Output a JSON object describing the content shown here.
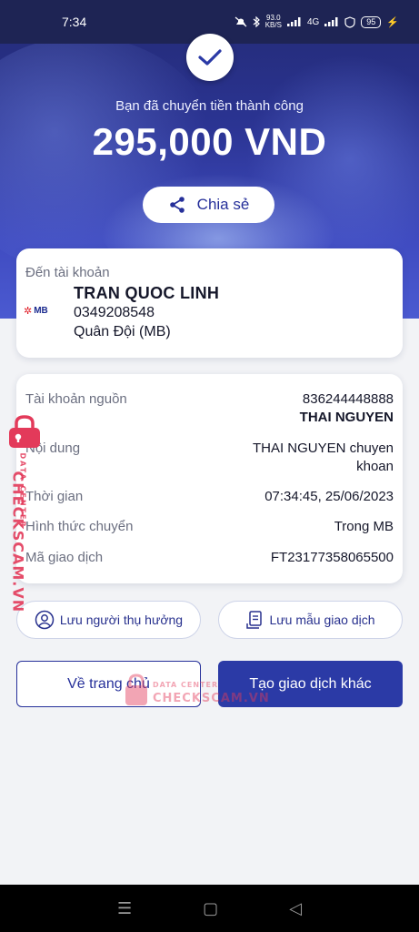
{
  "status": {
    "time": "7:34",
    "speed_value": "93.0",
    "speed_unit": "KB/S",
    "network": "4G",
    "battery": "95"
  },
  "hero": {
    "title": "Bạn đã chuyển tiền thành công",
    "amount": "295,000 VND",
    "share_label": "Chia sẻ"
  },
  "recipient": {
    "label": "Đến tài khoản",
    "bank_logo_text": "MB",
    "name": "TRAN QUOC LINH",
    "account": "0349208548",
    "bank": "Quân Đội (MB)"
  },
  "details": {
    "source_label": "Tài khoản nguồn",
    "source_account": "836244448888",
    "source_name": "THAI NGUYEN",
    "content_label": "Nội dung",
    "content_line1": "THAI NGUYEN chuyen",
    "content_line2": "khoan",
    "time_label": "Thời gian",
    "time_value": "07:34:45, 25/06/2023",
    "method_label": "Hình thức chuyển",
    "method_value": "Trong MB",
    "txn_label": "Mã giao dịch",
    "txn_value": "FT23177358065500"
  },
  "actions": {
    "save_beneficiary": "Lưu người thụ hưởng",
    "save_template": "Lưu mẫu giao dịch",
    "home": "Về trang chủ",
    "new_transaction": "Tạo giao dịch khác"
  },
  "watermark": {
    "brand": "CHECKSCAM.VN",
    "sub": "DATA CENTER"
  },
  "colors": {
    "primary": "#2b3aa6",
    "accent": "#e33a5a"
  }
}
